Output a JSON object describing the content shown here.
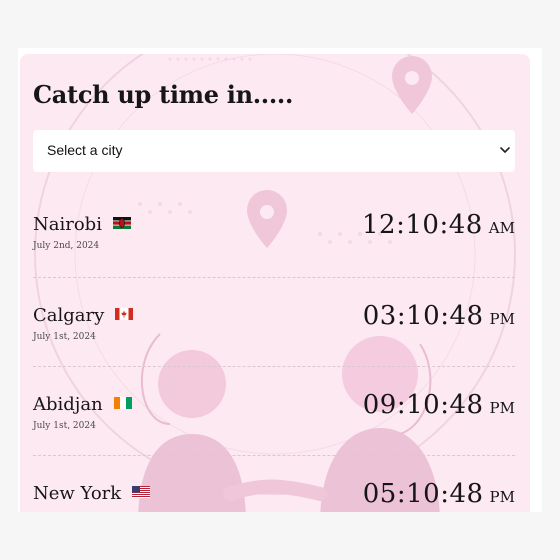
{
  "page": {
    "title": "Catch up time in....."
  },
  "city_select": {
    "value": "Select a city",
    "icon": "chevron-down-icon"
  },
  "cities": [
    {
      "name": "Nairobi",
      "flag": "kenya-flag-icon",
      "date": "July 2nd, 2024",
      "time": "12:10:48",
      "period": "AM"
    },
    {
      "name": "Calgary",
      "flag": "canada-flag-icon",
      "date": "July 1st, 2024",
      "time": "03:10:48",
      "period": "PM"
    },
    {
      "name": "Abidjan",
      "flag": "ivory-coast-flag-icon",
      "date": "July 1st, 2024",
      "time": "09:10:48",
      "period": "PM"
    },
    {
      "name": "New York",
      "flag": "usa-flag-icon",
      "date": "",
      "time": "05:10:48",
      "period": "PM"
    }
  ],
  "colors": {
    "card_background": "#fde9f2",
    "page_background": "#f6f6f6",
    "text": "#161616",
    "separator": "#dcc6d0",
    "illustration": "#f3c9dc"
  }
}
